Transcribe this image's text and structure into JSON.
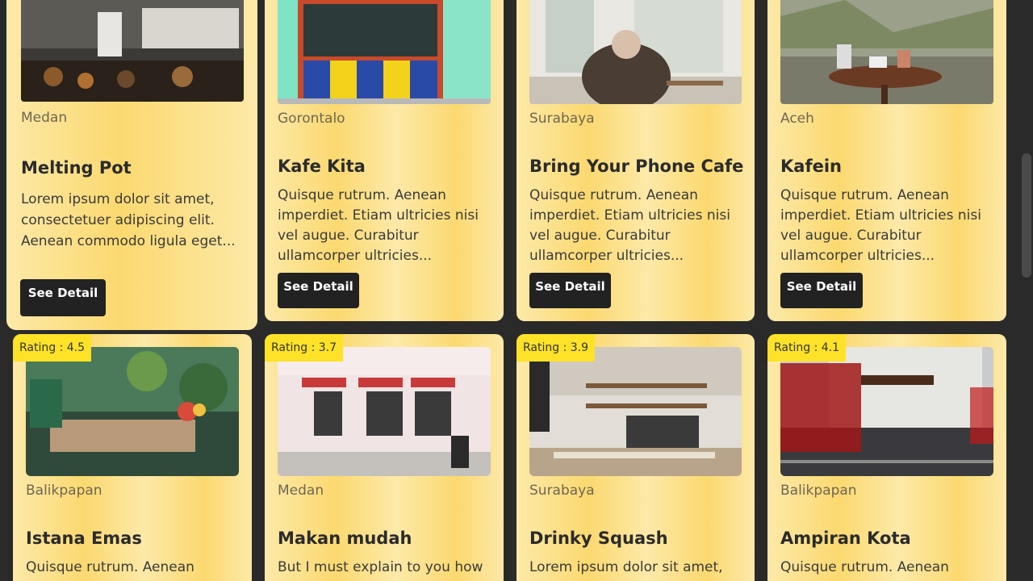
{
  "top_cards": [
    {
      "city": "Medan",
      "name": "Melting Pot",
      "desc": "Lorem ipsum dolor sit amet, consectetuer adipiscing elit. Aenean commodo ligula eget...",
      "button": "See Detail"
    },
    {
      "city": "Gorontalo",
      "name": "Kafe Kita",
      "desc": "Quisque rutrum. Aenean imperdiet. Etiam ultricies nisi vel augue. Curabitur ullamcorper ultricies...",
      "button": "See Detail"
    },
    {
      "city": "Surabaya",
      "name": "Bring Your Phone Cafe",
      "desc": "Quisque rutrum. Aenean imperdiet. Etiam ultricies nisi vel augue. Curabitur ullamcorper ultricies...",
      "button": "See Detail"
    },
    {
      "city": "Aceh",
      "name": "Kafein",
      "desc": "Quisque rutrum. Aenean imperdiet. Etiam ultricies nisi vel augue. Curabitur ullamcorper ultricies...",
      "button": "See Detail"
    }
  ],
  "bottom_cards": [
    {
      "rating": "Rating : 4.5",
      "city": "Balikpapan",
      "name": "Istana Emas",
      "desc": "Quisque rutrum. Aenean"
    },
    {
      "rating": "Rating : 3.7",
      "city": "Medan",
      "name": "Makan mudah",
      "desc": "But I must explain to you how all"
    },
    {
      "rating": "Rating : 3.9",
      "city": "Surabaya",
      "name": "Drinky Squash",
      "desc": "Lorem ipsum dolor sit amet,"
    },
    {
      "rating": "Rating : 4.1",
      "city": "Balikpapan",
      "name": "Ampiran Kota",
      "desc": "Quisque rutrum. Aenean"
    }
  ]
}
